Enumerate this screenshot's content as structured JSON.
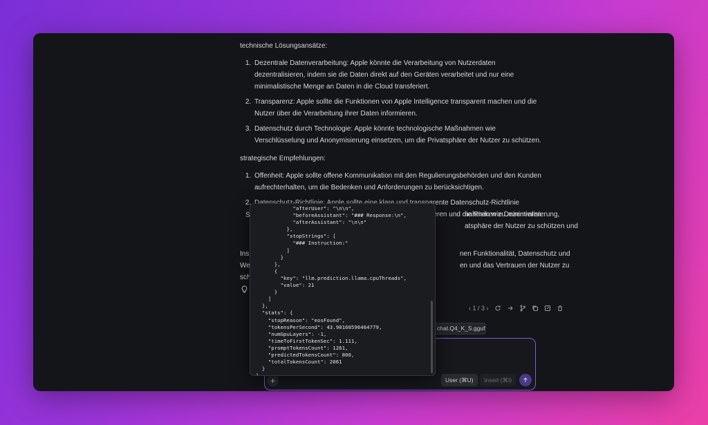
{
  "chat": {
    "section1_title": "technische Lösungsansätze:",
    "section1_items": [
      "Dezentrale Datenverarbeitung: Apple könnte die Verarbeitung von Nutzerdaten dezentralisieren, indem sie die Daten direkt auf den Geräten verarbeitet und nur eine minimalistische Menge an Daten in die Cloud transferiert.",
      "Transparenz: Apple sollte die Funktionen von Apple Intelligence transparent machen und die Nutzer über die Verarbeitung ihrer Daten informieren.",
      "Datenschutz durch Technologie: Apple könnte technologische Maßnahmen wie Verschlüsselung und Anonymisierung einsetzen, um die Privatsphäre der Nutzer zu schützen."
    ],
    "section2_title": "strategische Empfehlungen:",
    "section2_items": [
      "Offenheit: Apple sollte offene Kommunikation mit den Regulierungsbehörden und den Kunden aufrechterhalten, um die Bedenken und Anforderungen zu berücksichtigen.",
      "Datenschutz-Richtlinie: Apple sollte eine klare und transparente Datenschutz-Richtlinie entwickeln, um die Verarbeitung von Nutzerdaten zu regulieren und die Risiken zu minimieren."
    ],
    "item3_left": "S",
    "item3_right_line1": "nahmen wie Dezentralisierung,",
    "item3_right_line2": "atsphäre der Nutzer zu schützen und",
    "concl_left1": "Ins",
    "concl_right1": "nen Funktionalität, Datenschutz und",
    "concl_left2": "We",
    "concl_right2": "en und das Vertrauen der Nutzer zu",
    "concl_left3": "sch"
  },
  "toolbar": {
    "page_indicator": "‹ 1 / 3 ›"
  },
  "model_chip": "chat.Q4_K_S.gguf",
  "input": {
    "add_label": "+",
    "user_label": "User (⌘U)",
    "insert_label": "Insert (⌘I)"
  },
  "popup_json": "            \"afterUser\": \"\\n\\n\",\n            \"beforeAssistant\": \"### Response:\\n\",\n            \"afterAssistant\": \"\\n\\n\"\n          },\n          \"stopStrings\": [\n            \"### Instruction:\"\n          ]\n        }\n      },\n      {\n        \"key\": \"llm.prediction.llama.cpuThreads\",\n        \"value\": 21\n      }\n    ]\n  },\n  \"stats\": {\n    \"stopReason\": \"eosFound\",\n    \"tokensPerSecond\": 43.90160596464779,\n    \"numGpuLayers\": -1,\n    \"timeToFirstTokenSec\": 1.111,\n    \"promptTokensCount\": 1261,\n    \"predictedTokensCount\": 800,\n    \"totalTokensCount\": 2061\n  }\n}",
  "icons": [
    "lightbulb-icon",
    "regenerate-icon",
    "continue-icon",
    "branch-icon",
    "copy-icon",
    "edit-icon",
    "delete-icon",
    "send-icon"
  ]
}
